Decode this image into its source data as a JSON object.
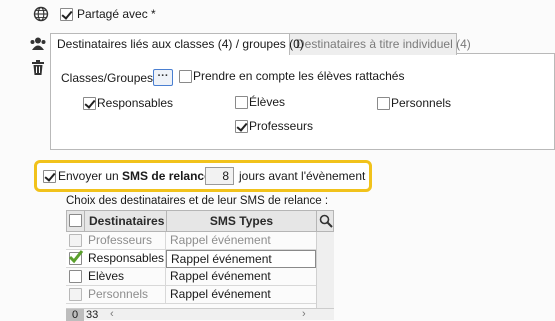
{
  "shared": {
    "label": "Partagé avec *",
    "checked": true
  },
  "tabs": [
    {
      "label": "Destinataires liés aux classes (4) / groupes (0)",
      "active": true
    },
    {
      "label": "Destinataires à titre individuel (4)",
      "active": false
    }
  ],
  "classes": {
    "label": "Classes/Groupes",
    "button_label": "···",
    "include_attached_label": "Prendre en compte les élèves rattachés",
    "options": [
      {
        "label": "Responsables",
        "checked": true
      },
      {
        "label": "Élèves",
        "checked": false
      },
      {
        "label": "Personnels",
        "checked": false
      },
      {
        "label": "Professeurs",
        "checked": true
      }
    ]
  },
  "sms": {
    "prefix": "Envoyer un ",
    "bold": "SMS de relance",
    "days": "8",
    "suffix": "jours avant l'évènement",
    "checked": true
  },
  "choice_label": "Choix des destinataires et de leur SMS de relance :",
  "grid": {
    "headers": [
      "Destinataires",
      "SMS Types"
    ],
    "rows": [
      {
        "recipient": "Professeurs",
        "sms": "Rappel événement",
        "checked": false,
        "active": false
      },
      {
        "recipient": "Responsables",
        "sms": "Rappel événement",
        "checked": true,
        "active": true
      },
      {
        "recipient": "Elèves",
        "sms": "Rappel événement",
        "checked": false,
        "active": true
      },
      {
        "recipient": "Personnels",
        "sms": "Rappel événement",
        "checked": false,
        "active": false
      }
    ],
    "footer": [
      "0",
      "33"
    ]
  },
  "icons": [
    "globe-icon",
    "users-icon",
    "trash-icon",
    "search-icon"
  ],
  "colors": {
    "highlight": "#f1c21b",
    "check_green": "#5aa02c",
    "tab_border": "#b9b9b9"
  }
}
